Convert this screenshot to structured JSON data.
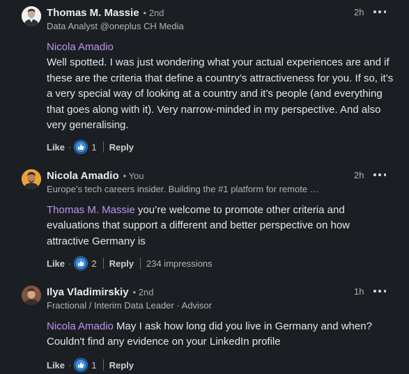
{
  "comments": [
    {
      "author": "Thomas M. Massie",
      "degree": "• 2nd",
      "headline": "Data Analyst @oneplus CH Media",
      "time": "2h",
      "mention": "Nicola Amadio",
      "text": "Well spotted. I was just wondering what your actual experiences are and if these are the criteria that define a country’s attractiveness for you. If so, it’s a very special way of looking at a country and it’s people (and everything that goes along with it). Very narrow-minded in my perspective. And also very generalising.",
      "like_label": "Like",
      "separator": "·",
      "reaction_count": "1",
      "reply_label": "Reply"
    },
    {
      "author": "Nicola Amadio",
      "degree": "• You",
      "headline": "Europe’s tech careers insider. Building the #1 platform for remote …",
      "time": "2h",
      "mention": "Thomas M. Massie",
      "text": " you’re welcome to promote other criteria and evaluations that support a different and better perspective on how attractive Germany is",
      "like_label": "Like",
      "separator": "·",
      "reaction_count": "2",
      "reply_label": "Reply",
      "impressions": "234 impressions"
    },
    {
      "author": "Ilya Vladimirskiy",
      "degree": "• 2nd",
      "headline": "Fractional / Interim Data Leader · Advisor",
      "time": "1h",
      "mention": "Nicola Amadio",
      "text": " May I ask how long did you live in Germany and when? Couldn't find any evidence on your LinkedIn profile",
      "like_label": "Like",
      "separator": "·",
      "reaction_count": "1",
      "reply_label": "Reply"
    }
  ],
  "colors": {
    "background": "#1b1f23",
    "mention": "#c193f0",
    "reaction": "#378fe9"
  },
  "icons": {
    "reaction": "thumbs-up-icon",
    "more": "more-options-icon"
  }
}
